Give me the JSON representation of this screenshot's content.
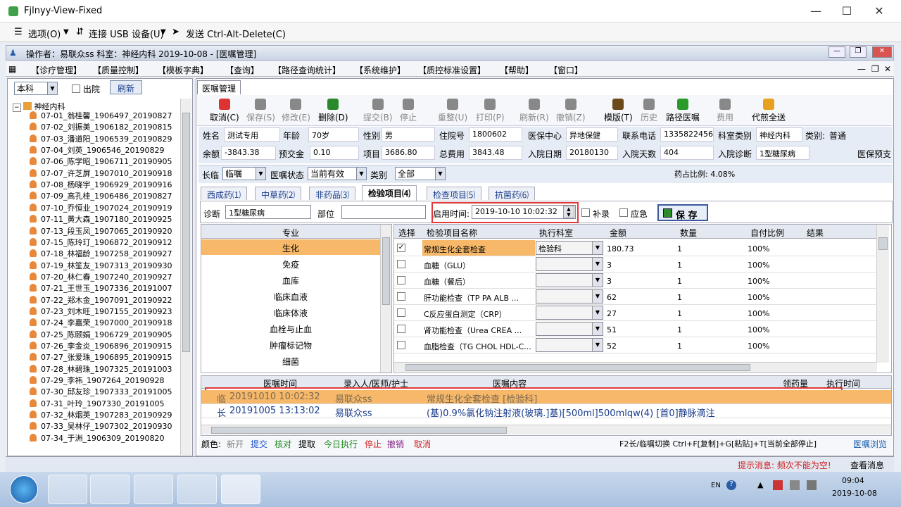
{
  "window": {
    "title": "Fjlnyy-View-Fixed",
    "minimize": "—",
    "maximize": "☐",
    "close": "✕"
  },
  "viewer_toolbar": {
    "options": "选项(O)",
    "usb": "连接 USB 设备(U)",
    "cad": "发送 Ctrl-Alt-Delete(C)"
  },
  "opbar": {
    "text": "操作者：易联众ss   科室：神经内科   2019-10-08 - [医嘱管理]"
  },
  "menu": [
    "【诊疗管理】",
    "【质量控制】",
    "【模板字典】",
    "【查询】",
    "【路径查询统计】",
    "【系统维护】",
    "【质控标准设置】",
    "【帮助】",
    "【窗口】"
  ],
  "left": {
    "scope": "本科",
    "discharged": "出院",
    "refresh": "刷新",
    "root": "神经内科",
    "patients": [
      "07-01_翁桂馨_1906497_20190827",
      "07-02_刘振美_1906182_20190815",
      "07-03_潘道阳_1906539_20190829",
      "07-04_刘英_1906546_20190829",
      "07-06_陈学昭_1906711_20190905",
      "07-07_许芝屏_1907010_20190918",
      "07-08_杨晓宇_1906929_20190916",
      "07-09_高孔桂_1906486_20190827",
      "07-10_乔恒业_1907024_20190919",
      "07-11_黄大森_1907180_20190925",
      "07-13_段玉凤_1907065_20190920",
      "07-15_陈玲玎_1906872_20190912",
      "07-18_林福龄_1907258_20190927",
      "07-19_林笙友_1907313_20190930",
      "07-20_林仁春_1907240_20190927",
      "07-21_王世玉_1907336_20191007",
      "07-22_郑木金_1907091_20190922",
      "07-23_刘木旺_1907155_20190923",
      "07-24_李嘉荣_1907000_20190918",
      "07-25_陈颐娟_1906729_20190905",
      "07-26_李金炎_1906896_20190915",
      "07-27_张爱珠_1906895_20190915",
      "07-28_林碧珠_1907325_20191003",
      "07-29_李祎_1907264_20190928",
      "07-30_邱友珍_1907333_20191005",
      "07-31_叶玲_1907330_20191005",
      "07-32_林烟英_1907283_20190929",
      "07-33_吴林仔_1907302_20190930",
      "07-34_于洲_1906309_20190820"
    ]
  },
  "main": {
    "tab": "医嘱管理",
    "toolbar": [
      {
        "label": "取消(C)",
        "enabled": true
      },
      {
        "label": "保存(S)",
        "enabled": false
      },
      {
        "label": "修改(E)",
        "enabled": false
      },
      {
        "label": "删除(D)",
        "enabled": true
      },
      {
        "label": "提交(B)",
        "enabled": false
      },
      {
        "label": "停止",
        "enabled": false
      },
      {
        "label": "重整(U)",
        "enabled": false
      },
      {
        "label": "打印(P)",
        "enabled": false
      },
      {
        "label": "刷新(R)",
        "enabled": false
      },
      {
        "label": "撤销(Z)",
        "enabled": false
      },
      {
        "label": "模版(T)",
        "enabled": true
      },
      {
        "label": "历史",
        "enabled": false
      },
      {
        "label": "路径医嘱",
        "enabled": true
      },
      {
        "label": "费用",
        "enabled": false
      },
      {
        "label": "代煎全送",
        "enabled": true
      }
    ],
    "patient": {
      "name_l": "姓名",
      "name": "测试专用",
      "age_l": "年龄",
      "age": "70岁",
      "sex_l": "性别",
      "sex": "男",
      "inno_l": "住院号",
      "inno": "1800602",
      "center_l": "医保中心",
      "center": "异地保健",
      "phone_l": "联系电话",
      "phone": "13358224565",
      "dept_l": "科室类别",
      "dept": "神经内科",
      "cat_l": "类别:",
      "cat": "普通",
      "bal_l": "余额",
      "bal": "-3843.38",
      "pre_l": "预交金",
      "pre": "0.10",
      "item_l": "项目",
      "item": "3686.80",
      "total_l": "总费用",
      "total": "3843.48",
      "indate_l": "入院日期",
      "indate": "20180130",
      "days_l": "入院天数",
      "days": "404",
      "diag_l": "入院诊断",
      "diag": "1型糖尿病",
      "ins_l": "医保预支"
    },
    "filters": {
      "long_l": "长临",
      "long": "临嘱",
      "status_l": "医嘱状态",
      "status": "当前有效",
      "type_l": "类别",
      "type": "全部",
      "drug_ratio": "药占比例: 4.08%"
    },
    "subtabs": [
      "西成药⑴",
      "中草药⑵",
      "非药品⑶",
      "检验项目⑷",
      "检查项目⑸",
      "抗菌药⑹"
    ],
    "order_form": {
      "diag_l": "诊断",
      "diag": "1型糖尿病",
      "site_l": "部位",
      "site": "",
      "time_l": "启用时间:",
      "time": "2019-10-10 10:02:32",
      "supp": "补录",
      "urgent": "应急",
      "save": "保 存"
    },
    "specialty": {
      "header": "专业",
      "items": [
        "生化",
        "免疫",
        "血库",
        "临床血液",
        "临床体液",
        "血栓与止血",
        "肿瘤标记物",
        "细菌"
      ]
    },
    "labgrid": {
      "headers": [
        "选择",
        "检验项目名称",
        "执行科室",
        "金额",
        "数量",
        "自付比例",
        "结果"
      ],
      "rows": [
        {
          "checked": true,
          "name": "常规生化全套检查",
          "dept": "检验科",
          "amount": "180.73",
          "qty": "1",
          "ratio": "100%"
        },
        {
          "checked": false,
          "name": "血糖（GLU）",
          "dept": "",
          "amount": "3",
          "qty": "1",
          "ratio": "100%"
        },
        {
          "checked": false,
          "name": "血糖（餐后）",
          "dept": "",
          "amount": "3",
          "qty": "1",
          "ratio": "100%"
        },
        {
          "checked": false,
          "name": "肝功能检查（TP PA ALB ...",
          "dept": "",
          "amount": "62",
          "qty": "1",
          "ratio": "100%"
        },
        {
          "checked": false,
          "name": "C反应蛋白测定（CRP）",
          "dept": "",
          "amount": "27",
          "qty": "1",
          "ratio": "100%"
        },
        {
          "checked": false,
          "name": "肾功能检查（Urea CREA ...",
          "dept": "",
          "amount": "51",
          "qty": "1",
          "ratio": "100%"
        },
        {
          "checked": false,
          "name": "血脂检查（TG CHOL HDL-C...",
          "dept": "",
          "amount": "52",
          "qty": "1",
          "ratio": "100%"
        }
      ]
    },
    "orders": {
      "headers": [
        "医嘱时间",
        "录入人/医师/护士",
        "医嘱内容",
        "领药量",
        "执行时间"
      ],
      "rows": [
        {
          "kind": "临",
          "time": "20191010 10:02:32",
          "who": "易联众ss",
          "content": "常规生化全套检查    [检验科]"
        },
        {
          "kind": "长",
          "time": "20191005 13:13:02",
          "who": "易联众ss",
          "content": "(基)0.9%氯化钠注射液(玻璃.]基)[500ml]500mlqw(4)  [首0]静脉滴注"
        }
      ]
    },
    "legend": {
      "label": "颜色:",
      "items": [
        {
          "t": "新开",
          "c": "#808080"
        },
        {
          "t": "提交",
          "c": "#2255cc"
        },
        {
          "t": "核对",
          "c": "#228822"
        },
        {
          "t": "提取",
          "c": "#000000"
        },
        {
          "t": "今日执行",
          "c": "#228822"
        },
        {
          "t": "停止",
          "c": "#d02020"
        },
        {
          "t": "撤销",
          "c": "#8a2a8a"
        },
        {
          "t": "取消",
          "c": "#d02020"
        }
      ],
      "hint": "F2长/临嘱切换 Ctrl+F[复制]+G[粘贴]+T[当前全部停止]",
      "browse": "医嘱浏览"
    }
  },
  "status": {
    "message": "提示消息: 频次不能为空!",
    "view": "查看消息>>"
  },
  "taskbar": {
    "lang": "EN",
    "time": "09:04",
    "date": "2019-10-08"
  }
}
